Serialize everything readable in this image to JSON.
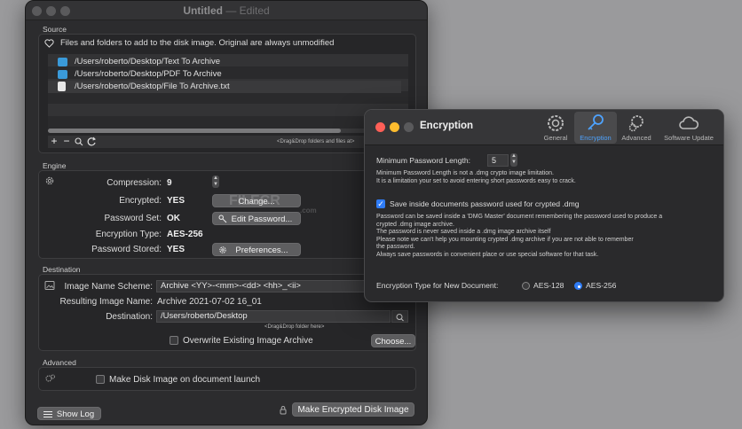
{
  "main_window": {
    "title": "Untitled",
    "title_suffix": "— Edited",
    "source": {
      "label": "Source",
      "description": "Files and folders to add to the disk image. Original are always unmodified",
      "files": [
        {
          "path": "/Users/roberto/Desktop/Text To Archive",
          "icon": "folder-icon"
        },
        {
          "path": "/Users/roberto/Desktop/PDF To Archive",
          "icon": "folder-icon"
        },
        {
          "path": "/Users/roberto/Desktop/File To Archive.txt",
          "icon": "document-icon"
        }
      ],
      "drop_hint": "<Drag&Drop folders and files at>"
    },
    "engine": {
      "label": "Engine",
      "compression_label": "Compression:",
      "compression_value": "9",
      "encrypted_label": "Encrypted:",
      "encrypted_value": "YES",
      "change_button": "Change...",
      "password_set_label": "Password Set:",
      "password_set_value": "OK",
      "edit_password_button": "Edit Password...",
      "encryption_type_label": "Encryption Type:",
      "encryption_type_value": "AES-256",
      "password_stored_label": "Password  Stored:",
      "password_stored_value": "YES",
      "preferences_button": "Preferences..."
    },
    "destination": {
      "label": "Destination",
      "image_name_scheme_label": "Image Name Scheme:",
      "image_name_scheme_value": "Archive <YY>-<mm>-<dd> <hh>_<ii>",
      "resulting_image_name_label": "Resulting Image Name:",
      "resulting_image_name_value": "Archive 2021-07-02 16_01",
      "destination_label": "Destination:",
      "destination_value": "/Users/roberto/Desktop",
      "drop_hint": "<Drag&Drop folder here>",
      "overwrite_label": "Overwrite Existing Image Archive",
      "choose_button": "Choose..."
    },
    "advanced": {
      "label": "Advanced",
      "make_on_launch_label": "Make Disk Image on document launch"
    },
    "footer": {
      "show_log_button": "Show Log",
      "make_button": "Make Encrypted Disk Image"
    }
  },
  "watermark": {
    "text": "FILECR",
    "sub": ".com"
  },
  "prefs_window": {
    "title": "Encryption",
    "tabs": [
      {
        "label": "General",
        "icon": "gear-icon",
        "active": false
      },
      {
        "label": "Encryption",
        "icon": "key-icon",
        "active": true
      },
      {
        "label": "Advanced",
        "icon": "gears-icon",
        "active": false
      },
      {
        "label": "Software Update",
        "icon": "cloud-icon",
        "active": false
      }
    ],
    "min_password_length_label": "Minimum Password Length:",
    "min_password_length_value": "5",
    "min_password_note_1": "Minimum Password Length is not a .dmg crypto image limitation.",
    "min_password_note_2": "It is a limitation your set to avoid entering short passwords easy to crack.",
    "save_password_label": "Save inside documents password used for crypted .dmg",
    "save_password_checked": true,
    "save_notes": [
      "Password can be saved inside a 'DMG Master' document remembering the password used to produce a",
      "crypted .dmg image archive.",
      "The password is never saved inside a .dmg image archive itself",
      "Please note we can't help you mounting crypted .dmg archive if you are not able to remember",
      "the password.",
      "Always save passwords in convenient place or use special software for that task."
    ],
    "encryption_type_label": "Encryption Type for New Document:",
    "encryption_options": [
      {
        "label": "AES-128",
        "selected": false
      },
      {
        "label": "AES-256",
        "selected": true
      }
    ],
    "colors": {
      "accent": "#2f7cf6",
      "close": "#ff5f57",
      "minimize": "#febc2e",
      "zoom": "#5a5a5c"
    }
  }
}
